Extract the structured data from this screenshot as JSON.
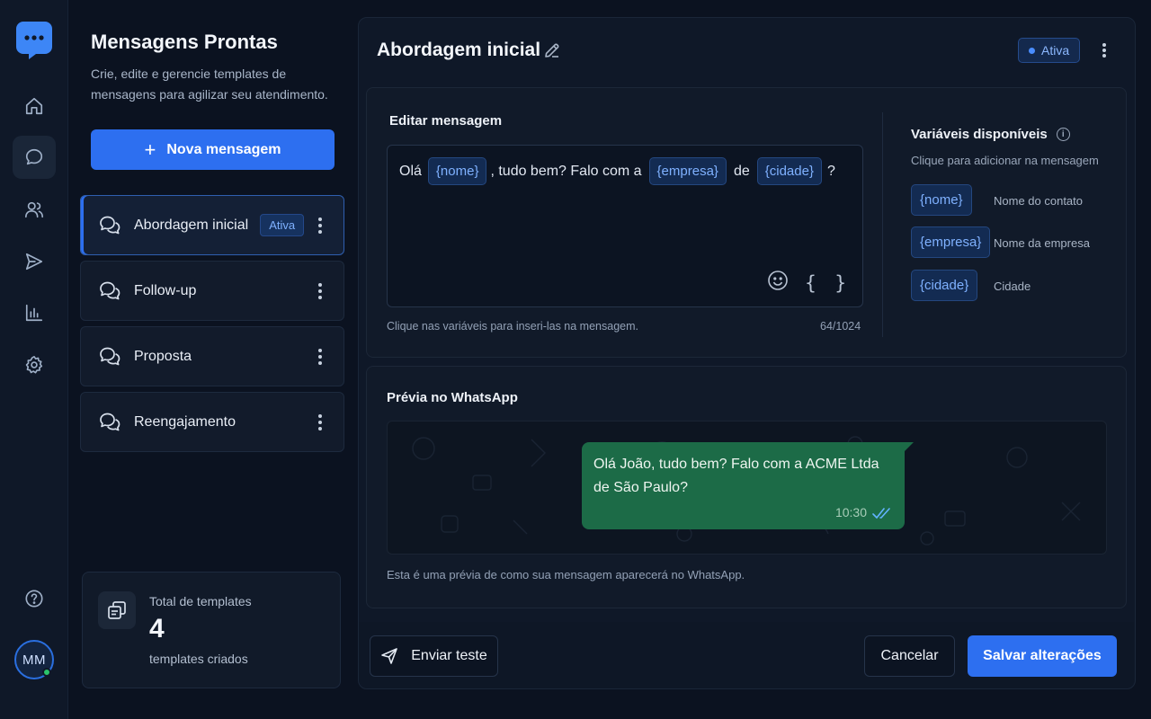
{
  "sidebar": {
    "logo_icon": "chat-bubble-logo-icon",
    "nav": [
      {
        "name": "home",
        "icon": "home-icon"
      },
      {
        "name": "messages",
        "icon": "chat-icon",
        "active": true
      },
      {
        "name": "contacts",
        "icon": "users-icon"
      },
      {
        "name": "campaigns",
        "icon": "send-icon"
      },
      {
        "name": "reports",
        "icon": "bar-chart-icon"
      },
      {
        "name": "settings",
        "icon": "gear-icon"
      }
    ],
    "help_icon": "help-circle-icon",
    "avatar_initials": "MM",
    "avatar_status_color": "#2bc46b"
  },
  "templates_panel": {
    "title": "Mensagens Prontas",
    "subtitle": "Crie, edite e gerencie templates de mensagens para agilizar seu atendimento.",
    "new_button_label": "Nova mensagem",
    "items": [
      {
        "name": "Abordagem inicial",
        "badge": "Ativa",
        "active": true
      },
      {
        "name": "Follow-up",
        "badge": ""
      },
      {
        "name": "Proposta",
        "badge": ""
      },
      {
        "name": "Reengajamento",
        "badge": ""
      }
    ],
    "stats": {
      "label": "Total de templates",
      "count": "4",
      "caption": "templates criados"
    }
  },
  "editor": {
    "template_title": "Abordagem inicial",
    "status_label": "Ativa",
    "section_title": "Editar mensagem",
    "message_parts": {
      "p1": "Olá",
      "v1": "{nome}",
      "p2": ", tudo bem? Falo com a",
      "v2": "{empresa}",
      "p3": "de",
      "v3": "{cidade}",
      "p4": "?"
    },
    "braces_label": "{ }",
    "hint": "Clique nas variáveis para inseri-las na mensagem.",
    "char_count": "64/1024"
  },
  "variables": {
    "title": "Variáveis disponíveis",
    "subtitle": "Clique para adicionar na mensagem",
    "items": [
      {
        "token": "{nome}",
        "description": "Nome do contato"
      },
      {
        "token": "{empresa}",
        "description": "Nome da empresa"
      },
      {
        "token": "{cidade}",
        "description": "Cidade"
      }
    ]
  },
  "preview": {
    "title": "Prévia no WhatsApp",
    "message": "Olá João, tudo bem? Falo com a ACME Ltda de São Paulo?",
    "time": "10:30",
    "note": "Esta é uma prévia de como sua mensagem aparecerá no WhatsApp."
  },
  "footer": {
    "send_test_label": "Enviar teste",
    "cancel_label": "Cancelar",
    "save_label": "Salvar alterações"
  },
  "colors": {
    "accent": "#2d6ff0",
    "bubble": "#1c6b47",
    "chip_text": "#7fb1ff"
  }
}
